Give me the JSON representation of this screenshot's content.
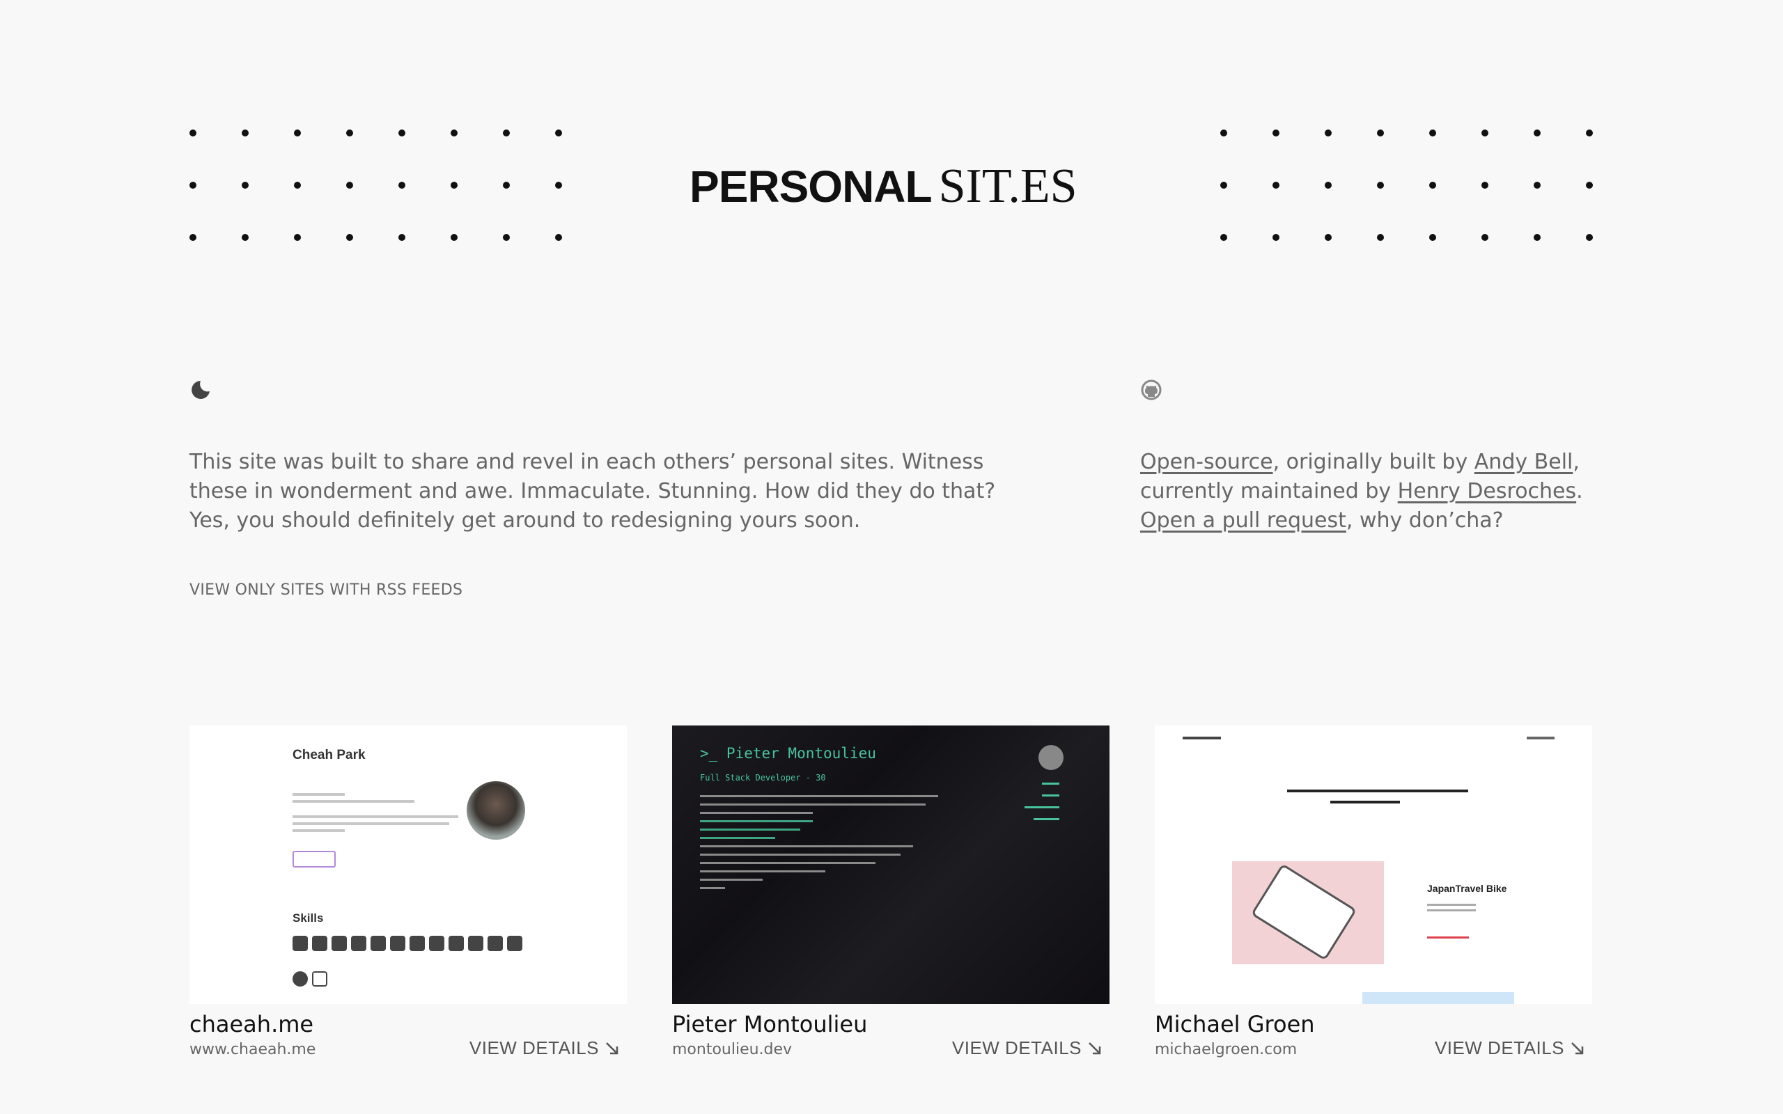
{
  "header": {
    "logo_bold": "PERSONAL",
    "logo_serif": "SIT.ES"
  },
  "icons": {
    "theme_toggle": "moon-icon",
    "source": "github-icon",
    "details_arrow": "arrow-down-right-icon"
  },
  "intro": {
    "text": "This site was built to share and revel in each others’ personal sites. Witness these in wonderment and awe. Immaculate. Stunning. How did they do that? Yes, you should definitely get around to redesigning yours soon."
  },
  "credits": {
    "open_source": "Open-source",
    "text1": ", originally built by ",
    "andy": "Andy Bell",
    "text2": ", currently maintained by ",
    "henry": "Henry Desroches",
    "text3": ". ",
    "pull_request": "Open a pull request",
    "text4": ", why don’cha?"
  },
  "rss_link": "VIEW ONLY SITES WITH RSS FEEDS",
  "sites": [
    {
      "name": "chaeah.me",
      "url": "www.chaeah.me",
      "details": "VIEW DETAILS",
      "thumb_title": "Cheah Park",
      "thumb_section": "Skills"
    },
    {
      "name": "Pieter Montoulieu",
      "url": "montoulieu.dev",
      "details": "VIEW DETAILS",
      "thumb_title": ">_ Pieter Montoulieu",
      "thumb_subtitle": "Full Stack Developer - 30"
    },
    {
      "name": "Michael Groen",
      "url": "michaelgroen.com",
      "details": "VIEW DETAILS",
      "thumb_title": "JapanTravel Bike"
    }
  ],
  "colors": {
    "background": "#f8f8f8",
    "text_muted": "#666666",
    "accent_green": "#47c49c",
    "accent_red": "#e0424d"
  }
}
